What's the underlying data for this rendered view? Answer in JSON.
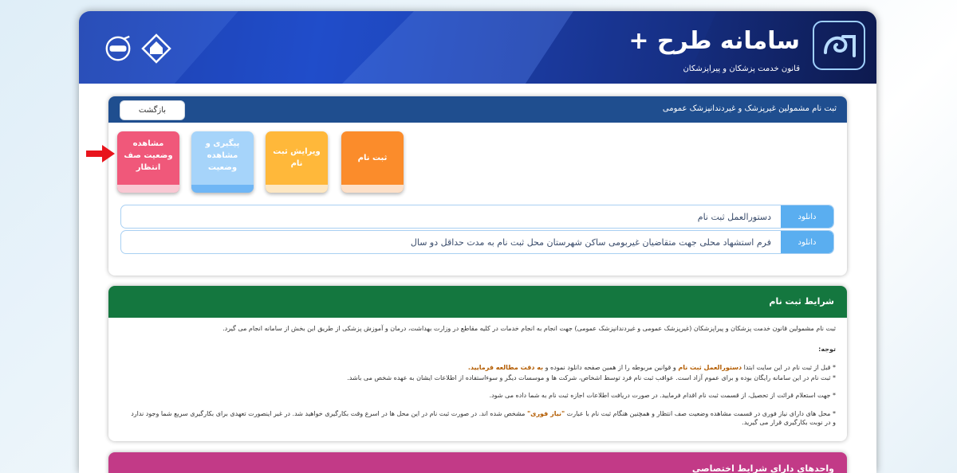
{
  "header": {
    "site_title": "سامانه طرح +",
    "site_subtitle": "قانون خدمت پزشکان و پیراپزشکان",
    "icons": [
      "tarh-logo-icon",
      "home-badge-icon",
      "roshd-badge-icon"
    ]
  },
  "registration": {
    "heading": "ثبت نام مشمولین غیرپزشک و غیردندانپزشک عمومی",
    "back_label": "بازگشت",
    "tiles": [
      {
        "label": "ثبت نام",
        "color": "#fb8c2b"
      },
      {
        "label": "ویرایش ثبت نام",
        "color": "#ffb83a"
      },
      {
        "label": "پیگیری و مشاهده وضعیت",
        "color": "#a6d4fa"
      },
      {
        "label": "مشاهده وضعیت صف انتظار",
        "color": "#f0587a"
      }
    ],
    "downloads": [
      {
        "button": "دانلود",
        "text": "دستورالعمل ثبت نام"
      },
      {
        "button": "دانلود",
        "text": "فرم استشهاد محلی جهت متقاضیان غیربومی ساکن شهرستان محل ثبت نام به مدت حداقل دو سال"
      }
    ]
  },
  "conditions": {
    "heading": "شرایط ثبت نام",
    "intro": "ثبت نام مشمولین قانون خدمت پزشکان و پیراپزشکان (غیرپزشک عمومی و غیردندانپزشک عمومی) جهت انجام به انجام خدمات در کلیه مقاطع در وزارت بهداشت، درمان و آموزش پزشکی از طریق این بخش از سامانه انجام می گیرد.",
    "note_label": "توجه:",
    "items": [
      {
        "before": "* قبل از ثبت نام در این سایت ابتدا ",
        "highlight": "دستورالعمل ثبت نام",
        "after": " و قوانین مربوطه را از همین صفحه دانلود نموده و ",
        "highlight2": "به دقت مطالعه فرمایید."
      },
      {
        "before": "* ثبت نام در این سامانه رایگان بوده و برای عموم آزاد است. عواقب ثبت نام فرد توسط اشخاص، شرکت ها و موسسات دیگر و سوءاستفاده از اطلاعات ایشان به عهده شخص می باشد.",
        "highlight": "",
        "after": "",
        "highlight2": ""
      },
      {
        "before": "* جهت استعلام قرائت از تحصیل، از قسمت ثبت نام اقدام فرمایید. در صورت دریافت اطلاعات اجازه ثبت نام به شما داده می شود.",
        "highlight": "",
        "after": "",
        "highlight2": ""
      },
      {
        "before": "* محل های دارای نیاز فوری در قسمت مشاهده وضعیت صف انتظار و همچنین هنگام ثبت نام با عبارت ",
        "highlight": "\"نیاز فوری\"",
        "after": " مشخص شده اند. در صورت ثبت نام در این محل ها در اسرع وقت بکارگیری خواهید شد. در غیر اینصورت تعهدی برای بکارگیری سریع شما وجود ندارد و در نوبت بکارگیری قرار می گیرید.",
        "highlight2": ""
      }
    ]
  },
  "special_units": {
    "heading": "واحدهای دارای شرایط اختصاصی"
  },
  "colors": {
    "banner": "#1e4bc6",
    "card_header_blue": "#1f4e8f",
    "card_header_green": "#14773f",
    "card_header_pink": "#c23a87",
    "download_button": "#5aaef0",
    "arrow": "#e8141c"
  }
}
